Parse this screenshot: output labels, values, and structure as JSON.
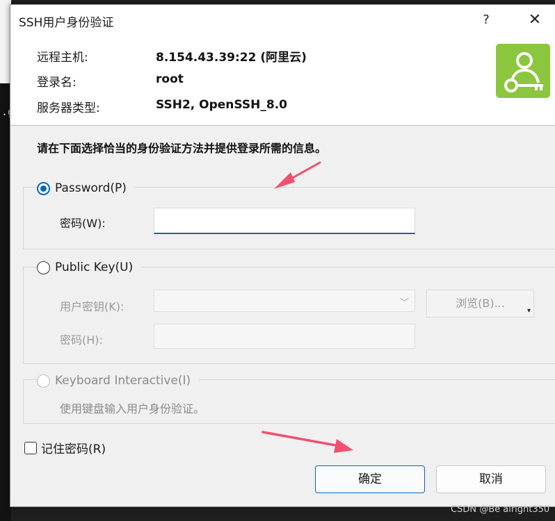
{
  "background": {
    "fragment_text": ".g"
  },
  "window": {
    "title": "SSH用户身份验证",
    "help_glyph": "?",
    "close_glyph": "✕"
  },
  "info": {
    "host_label": "远程主机:",
    "host_value": "8.154.43.39:22 (阿里云)",
    "login_label": "登录名:",
    "login_value": "root",
    "server_type_label": "服务器类型:",
    "server_type_value": "SSH2, OpenSSH_8.0",
    "icon": "user-key-icon",
    "icon_color": "#8cc63f"
  },
  "instruction": "请在下面选择恰当的身份验证方法并提供登录所需的信息。",
  "password_method": {
    "label": "Password(P)",
    "selected": true,
    "password_label": "密码(W):",
    "password_value": ""
  },
  "publickey_method": {
    "label": "Public Key(U)",
    "selected": false,
    "user_key_label": "用户密钥(K):",
    "user_key_value": "",
    "browse_label": "浏览(B)...",
    "passphrase_label": "密码(H):",
    "passphrase_value": ""
  },
  "keyboard_method": {
    "label": "Keyboard Interactive(I)",
    "selected": false,
    "enabled": false,
    "description": "使用键盘输入用户身份验证。"
  },
  "remember_password": {
    "label": "记住密码(R)",
    "checked": false
  },
  "buttons": {
    "ok": "确定",
    "cancel": "取消"
  },
  "annotations": {
    "arrow_color": "#f0506e"
  },
  "watermark": "CSDN @Be alright350"
}
